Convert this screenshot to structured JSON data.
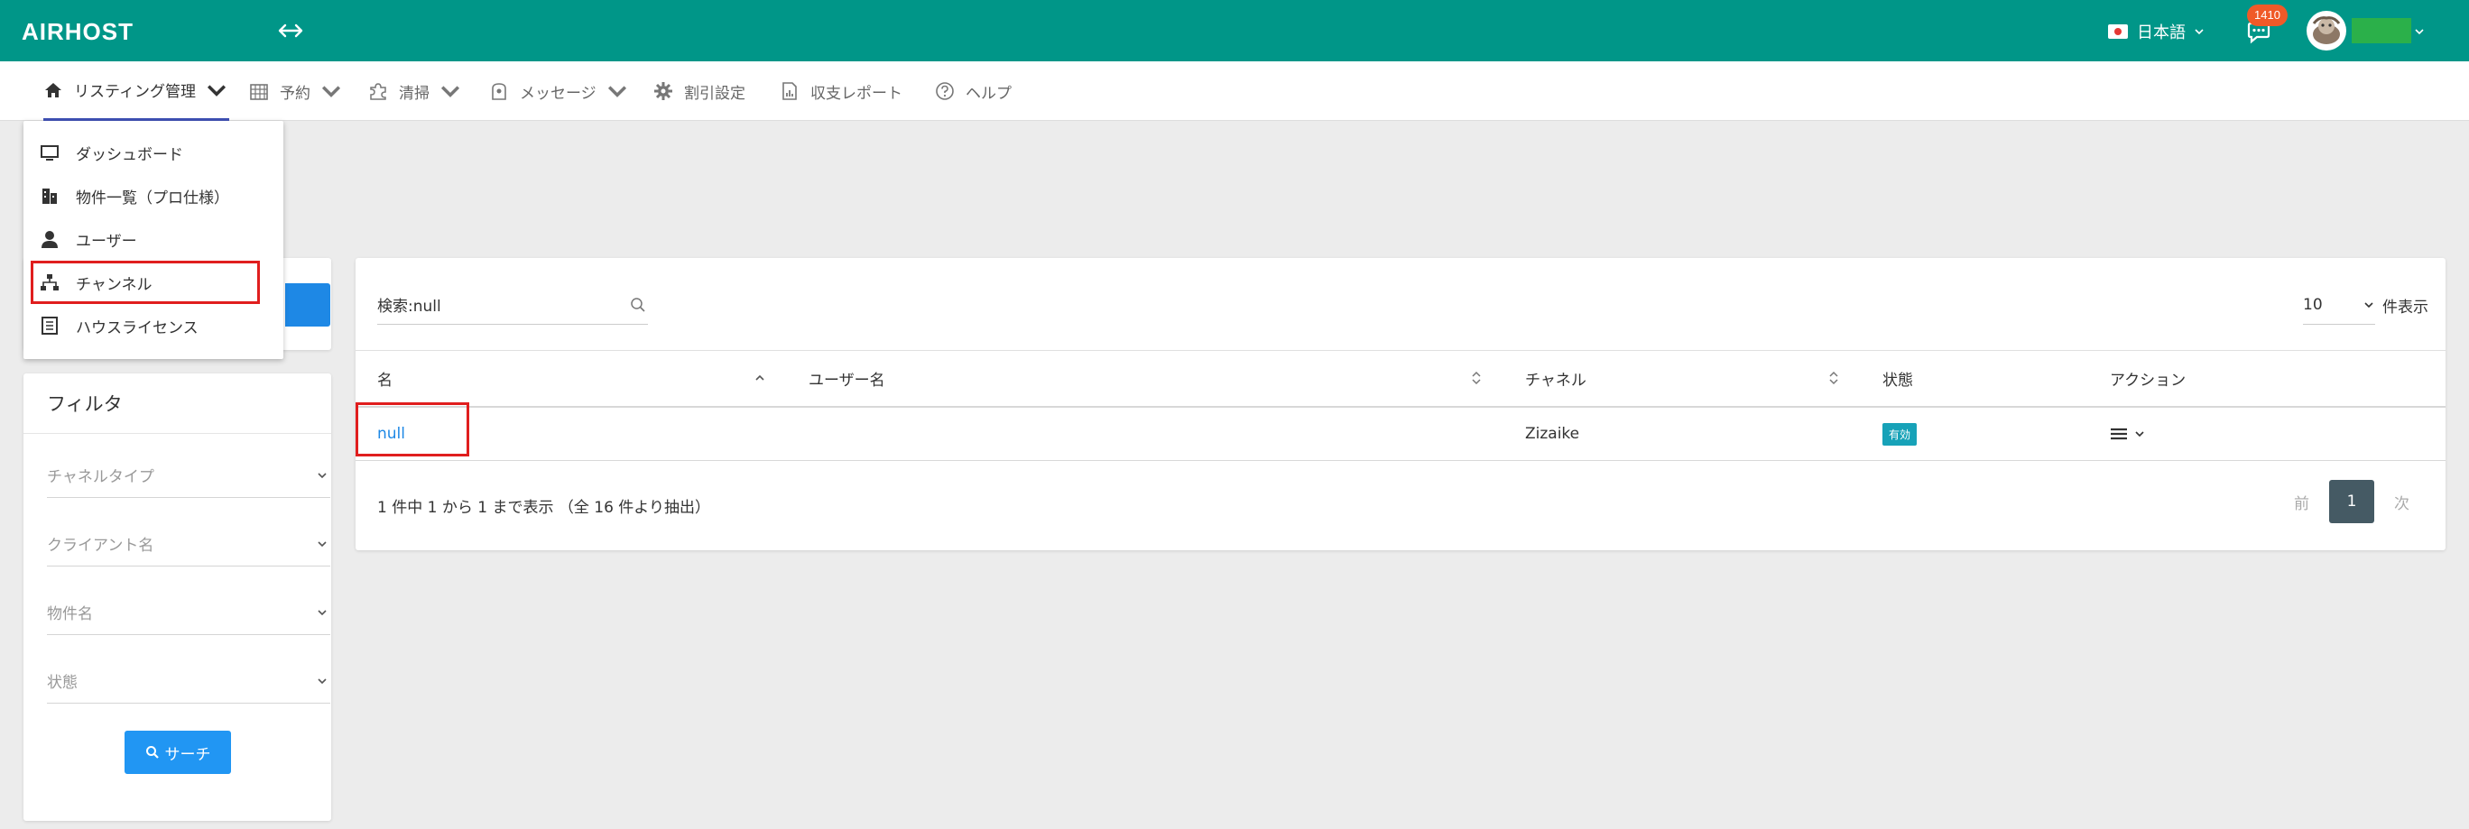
{
  "app": {
    "logo": "AIRHOST"
  },
  "header": {
    "language": "日本語",
    "notification_count": "1410"
  },
  "nav": {
    "items": [
      {
        "label": "リスティング管理"
      },
      {
        "label": "予約"
      },
      {
        "label": "清掃"
      },
      {
        "label": "メッセージ"
      },
      {
        "label": "割引設定"
      },
      {
        "label": "収支レポート"
      },
      {
        "label": "ヘルプ"
      }
    ]
  },
  "dropdown": {
    "items": [
      {
        "label": "ダッシュボード"
      },
      {
        "label": "物件一覧（プロ仕様）"
      },
      {
        "label": "ユーザー"
      },
      {
        "label": "チャンネル"
      },
      {
        "label": "ハウスライセンス"
      }
    ]
  },
  "filter": {
    "title": "フィルタ",
    "fields": [
      "チャネルタイプ",
      "クライアント名",
      "物件名",
      "状態"
    ],
    "search_label": "サーチ"
  },
  "table": {
    "search_value": "検索:null",
    "per_page_value": "10",
    "per_page_suffix": "件表示",
    "columns": [
      "名",
      "ユーザー名",
      "チャネル",
      "状態",
      "アクション"
    ],
    "rows": [
      {
        "name": "null",
        "user": "",
        "channel": "Zizaike",
        "status": "有効"
      }
    ],
    "summary": "1 件中 1 から 1 まで表示 （全 16 件より抽出）",
    "pager": {
      "prev": "前",
      "current": "1",
      "next": "次"
    }
  },
  "colors": {
    "header_bg": "#009688",
    "primary": "#2196f3",
    "highlight": "#e01e1e",
    "status_active": "#17a2b8",
    "notification": "#f05a28"
  }
}
